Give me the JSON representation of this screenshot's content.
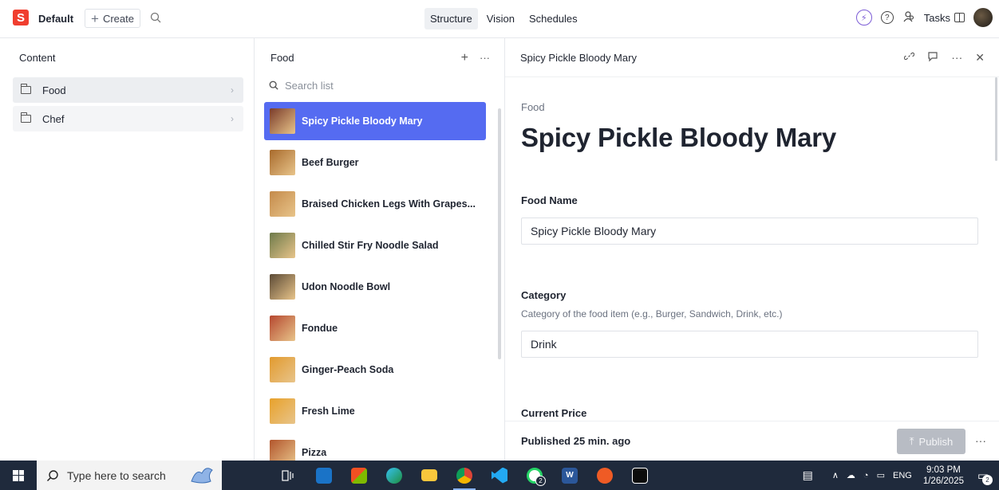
{
  "topbar": {
    "logo_letter": "S",
    "workspace": "Default",
    "create_label": "Create",
    "nav_tabs": [
      "Structure",
      "Vision",
      "Schedules"
    ],
    "active_tab": "Structure",
    "tasks_label": "Tasks"
  },
  "content_pane": {
    "title": "Content",
    "items": [
      {
        "label": "Food",
        "selected": true
      },
      {
        "label": "Chef",
        "selected": false
      }
    ]
  },
  "list_pane": {
    "title": "Food",
    "search_placeholder": "Search list",
    "items": [
      {
        "label": "Spicy Pickle Bloody Mary",
        "selected": true,
        "thumb_color": "#7a3b2a"
      },
      {
        "label": "Beef Burger",
        "thumb_color": "#a86a2c"
      },
      {
        "label": "Braised Chicken Legs With Grapes...",
        "thumb_color": "#c48a4a"
      },
      {
        "label": "Chilled Stir Fry Noodle Salad",
        "thumb_color": "#6d7a4a"
      },
      {
        "label": "Udon Noodle Bowl",
        "thumb_color": "#5b4a36"
      },
      {
        "label": "Fondue",
        "thumb_color": "#b5472f"
      },
      {
        "label": "Ginger-Peach Soda",
        "thumb_color": "#e29a2e"
      },
      {
        "label": "Fresh Lime",
        "thumb_color": "#e8a12a"
      },
      {
        "label": "Pizza",
        "thumb_color": "#b2552c"
      }
    ]
  },
  "document": {
    "header_title": "Spicy Pickle Bloody Mary",
    "breadcrumb": "Food",
    "title": "Spicy Pickle Bloody Mary",
    "fields": {
      "food_name_label": "Food Name",
      "food_name_value": "Spicy Pickle Bloody Mary",
      "category_label": "Category",
      "category_desc": "Category of the food item (e.g., Burger, Sandwich, Drink, etc.)",
      "category_value": "Drink",
      "price_label": "Current Price"
    },
    "status": "Published 25 min. ago",
    "publish_label": "Publish"
  },
  "taskbar": {
    "search_placeholder": "Type here to search",
    "time": "9:03 PM",
    "date": "1/26/2025",
    "lang": "ENG",
    "whatsapp_badge": "2",
    "notif_badge": "2"
  }
}
